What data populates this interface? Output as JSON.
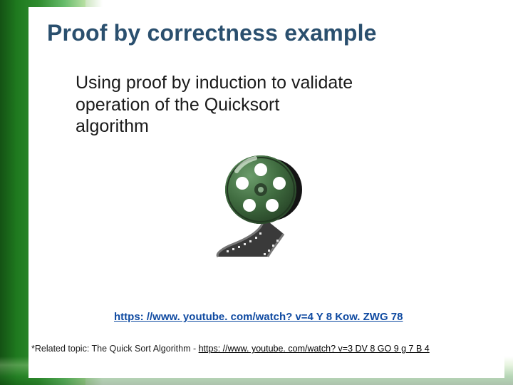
{
  "title": "Proof by correctness example",
  "subtitle": "Using proof by induction to validate operation of the Quicksort algorithm",
  "main_link": {
    "text": "https: //www. youtube. com/watch? v=4 Y 8 Kow. ZWG 78",
    "href": "https://www.youtube.com/watch?v=4Y8KowZWG78"
  },
  "related": {
    "label": "*Related topic: The Quick Sort Algorithm - ",
    "link_text": "https: //www. youtube. com/watch? v=3 DV 8 GO 9 g 7 B 4",
    "href": "https://www.youtube.com/watch?v=3DV8GO9g7B4"
  },
  "icons": {
    "film_reel": "film-reel-icon"
  }
}
